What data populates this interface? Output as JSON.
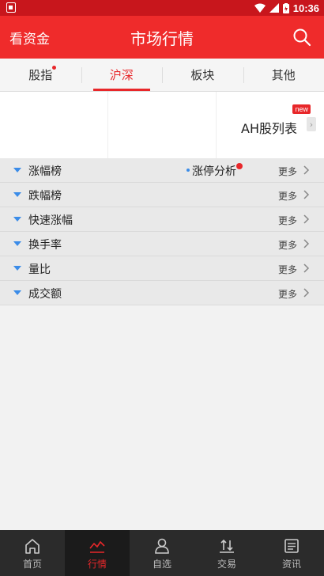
{
  "status_bar": {
    "time": "10:36"
  },
  "app_bar": {
    "left_action": "看资金",
    "title": "市场行情"
  },
  "tabs": [
    {
      "label": "股指",
      "dot": true
    },
    {
      "label": "沪深",
      "active": true
    },
    {
      "label": "板块"
    },
    {
      "label": "其他"
    }
  ],
  "grid": {
    "ah_label": "AH股列表",
    "new_badge": "new"
  },
  "list": {
    "more_label": "更多",
    "rows": [
      {
        "label": "涨幅榜",
        "extra": "涨停分析"
      },
      {
        "label": "跌幅榜"
      },
      {
        "label": "快速涨幅"
      },
      {
        "label": "换手率"
      },
      {
        "label": "量比"
      },
      {
        "label": "成交额"
      }
    ]
  },
  "bottom_nav": [
    {
      "label": "首页",
      "icon": "home-icon"
    },
    {
      "label": "行情",
      "icon": "chart-icon",
      "active": true
    },
    {
      "label": "自选",
      "icon": "person-icon"
    },
    {
      "label": "交易",
      "icon": "trade-icon"
    },
    {
      "label": "资讯",
      "icon": "news-icon"
    }
  ],
  "colors": {
    "brand_red": "#ef2b2b",
    "status_red": "#c8161c",
    "accent_blue": "#3b8ce8",
    "nav_bg": "#2b2b2b"
  }
}
